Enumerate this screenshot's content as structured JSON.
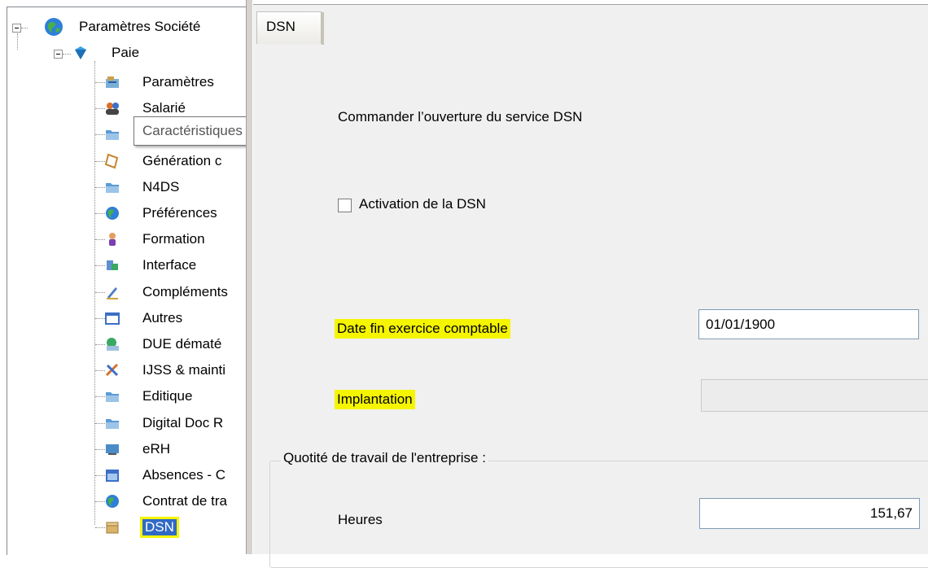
{
  "tree": {
    "root": {
      "label": "Paramètres Société",
      "icon": "globe-icon"
    },
    "paie": {
      "label": "Paie",
      "icon": "diamond-icon"
    },
    "items": [
      {
        "label": "Paramètres",
        "icon": "settings-icon"
      },
      {
        "label": "Salarié",
        "icon": "people-icon"
      },
      {
        "label": "Caractéristiques",
        "icon": "folder-icon"
      },
      {
        "label": "Génération c",
        "icon": "document-icon"
      },
      {
        "label": "N4DS",
        "icon": "folder-icon"
      },
      {
        "label": "Préférences",
        "icon": "globe-icon"
      },
      {
        "label": "Formation",
        "icon": "person-icon"
      },
      {
        "label": "Interface",
        "icon": "interface-icon"
      },
      {
        "label": "Compléments",
        "icon": "pen-icon"
      },
      {
        "label": "Autres",
        "icon": "window-icon"
      },
      {
        "label": "DUE dématé",
        "icon": "email-icon"
      },
      {
        "label": "IJSS & mainti",
        "icon": "tools-icon"
      },
      {
        "label": "Editique",
        "icon": "folder-icon"
      },
      {
        "label": "Digital Doc R",
        "icon": "folder-icon"
      },
      {
        "label": "eRH",
        "icon": "monitor-icon"
      },
      {
        "label": "Absences - C",
        "icon": "calendar-icon"
      },
      {
        "label": "Contrat de tra",
        "icon": "globe-icon"
      },
      {
        "label": "DSN",
        "icon": "box-icon"
      }
    ],
    "tooltip": "Caractéristiques"
  },
  "tab": {
    "label": "DSN"
  },
  "form": {
    "command_text": "Commander l’ouverture du service DSN",
    "activation_label": "Activation de la DSN",
    "date_label": "Date fin exercice comptable",
    "date_value": "01/01/1900",
    "implantation_label": "Implantation",
    "implantation_value": "",
    "group_title": "Quotité de travail de l'entreprise :",
    "heures_label": "Heures",
    "heures_value": "151,67"
  },
  "colors": {
    "highlight": "#f5f500",
    "selection": "#316ac5",
    "panel_bg": "#f0f0f0"
  }
}
